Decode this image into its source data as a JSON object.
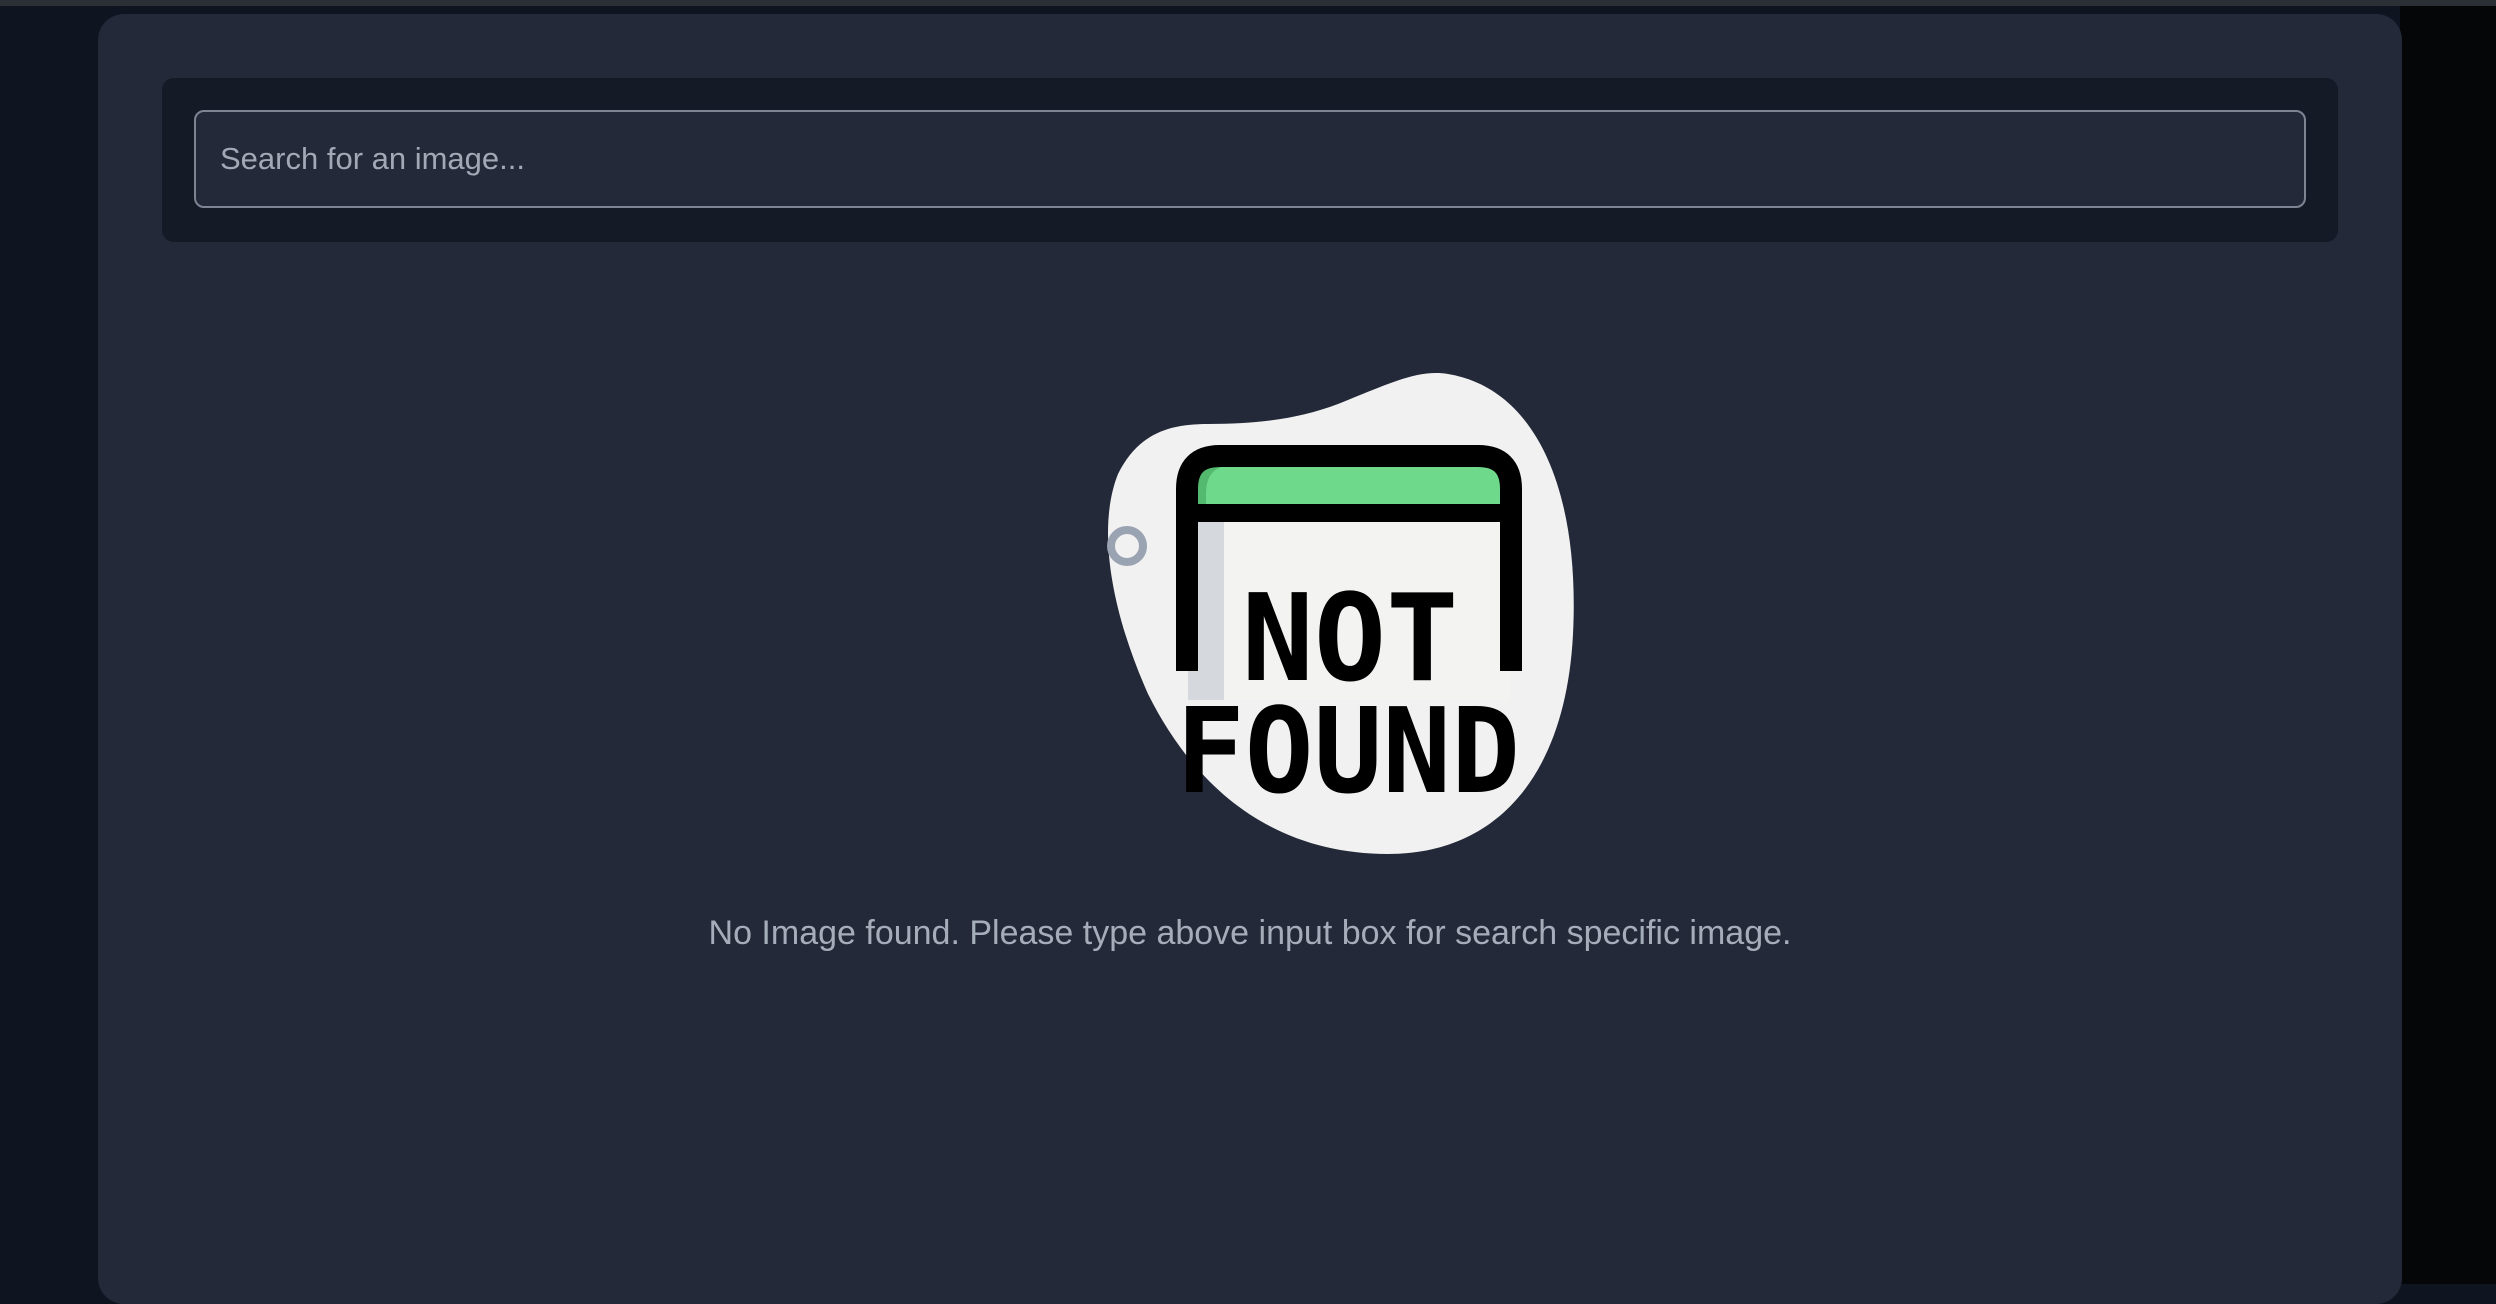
{
  "search": {
    "placeholder": "Search for an image..."
  },
  "empty_state": {
    "illustration_word_1": "NOT",
    "illustration_word_2": "FOUND",
    "message": "No Image found. Please type above input box for search specific image."
  },
  "colors": {
    "panel_background": "#232938",
    "search_bar_background": "#141a26",
    "illustration_blob": "#f1f1f1",
    "illustration_accent": "#6ed98b",
    "message_text": "#a6adba"
  }
}
